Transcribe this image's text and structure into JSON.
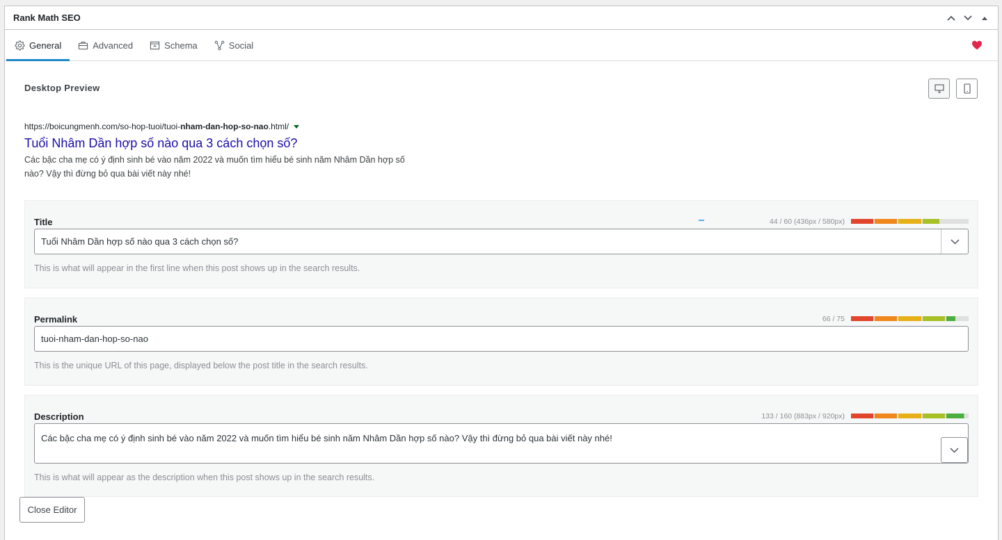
{
  "metabox": {
    "title": "Rank Math SEO"
  },
  "tabs": [
    {
      "label": "General",
      "icon": "gear-icon",
      "active": true
    },
    {
      "label": "Advanced",
      "icon": "briefcase-icon",
      "active": false
    },
    {
      "label": "Schema",
      "icon": "schema-icon",
      "active": false
    },
    {
      "label": "Social",
      "icon": "social-icon",
      "active": false
    }
  ],
  "preview": {
    "label": "Desktop Preview",
    "url_prefix": "https://boicungmenh.com/so-hop-tuoi/tuoi-",
    "url_bold": "nham-dan-hop-so-nao",
    "url_suffix": ".html/",
    "title": "Tuổi Nhâm Dần hợp số nào qua 3 cách chọn số?",
    "description": "Các bậc cha mẹ có ý định sinh bé vào năm 2022 và muốn tìm hiểu bé sinh năm Nhâm Dần hợp số nào? Vậy thì đừng bỏ qua bài viết này nhé!"
  },
  "fields": {
    "title": {
      "label": "Title",
      "counter": "44 / 60 (436px / 580px)",
      "progress": 0.75,
      "value": "Tuổi Nhâm Dần hợp số nào qua 3 cách chọn số?",
      "help": "This is what will appear in the first line when this post shows up in the search results."
    },
    "permalink": {
      "label": "Permalink",
      "counter": "66 / 75",
      "progress": 0.88,
      "value": "tuoi-nham-dan-hop-so-nao",
      "help": "This is the unique URL of this page, displayed below the post title in the search results."
    },
    "description": {
      "label": "Description",
      "counter": "133 / 160 (883px / 920px)",
      "progress": 0.96,
      "value": "Các bậc cha mẹ có ý định sinh bé vào năm 2022 và muốn tìm hiểu bé sinh năm Nhâm Dần hợp số nào? Vậy thì đừng bỏ qua bài viết này nhé!",
      "help": "This is what will appear as the description when this post shows up in the search results."
    }
  },
  "close_button": "Close Editor",
  "colors": {
    "accent": "#1e88c7",
    "heart": "#e2264d",
    "serp_title": "#1a0dab",
    "bar_segments": [
      "#e1462c",
      "#f0871c",
      "#e6b117",
      "#a6c026",
      "#4caf3d"
    ]
  }
}
